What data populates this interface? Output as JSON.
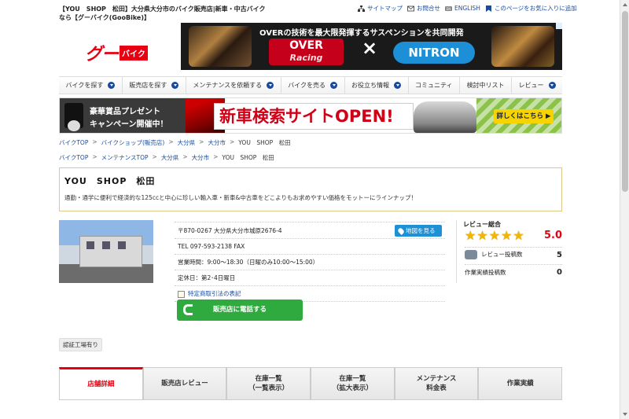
{
  "page": {
    "title": "【YOU　SHOP　松田】大分県大分市のバイク販売店|新車・中古バイクなら【グーバイク(GooBike)】"
  },
  "util_links": [
    {
      "label": "サイトマップ",
      "icon": "sitemap-icon"
    },
    {
      "label": "お問合せ",
      "icon": "mail-icon"
    },
    {
      "label": "ENGLISH",
      "icon": "globe-icon"
    },
    {
      "label": "このページをお気に入りに追加",
      "icon": "bookmark-icon"
    }
  ],
  "logo": {
    "goo": "グー",
    "bike": "バイク"
  },
  "ad_top": {
    "headline": "OVERの技術を最大限発揮するサスペンションを共同開発",
    "brand_left": "OVER",
    "brand_left_sub": "Racing",
    "times": "×",
    "brand_right": "NITRON"
  },
  "gnav": [
    {
      "label": "バイクを探す"
    },
    {
      "label": "販売店を探す"
    },
    {
      "label": "メンテナンスを依頼する"
    },
    {
      "label": "バイクを売る"
    },
    {
      "label": "お役立ち情報"
    },
    {
      "label": "コミュニティ"
    },
    {
      "label": "検討中リスト"
    },
    {
      "label": "レビュー"
    }
  ],
  "ad_mid": {
    "line1": "豪華賞品プレゼント",
    "line2": "キャンペーン開催中！",
    "big": "新車検索サイトOPEN!",
    "detail": "詳しくはこちら ▶"
  },
  "breadcrumb1": [
    "バイクTOP",
    "バイクショップ(販売店)",
    "大分県",
    "大分市",
    "YOU　SHOP　松田"
  ],
  "breadcrumb2": [
    "バイクTOP",
    "メンテナンスTOP",
    "大分県",
    "大分市",
    "YOU　SHOP　松田"
  ],
  "shop": {
    "name": "YOU　SHOP　松田",
    "description": "通勤・通学に便利で経済的な125ccと中心に珍しい輸入車・新車&中古車をどこよりもお求めやすい価格をモットーにラインナップ！",
    "address": "〒870-0267 大分県大分市城原2676-4",
    "map_button": "地図を見る",
    "tel": "TEL 097-593-2138 FAX",
    "hours": "営業時間：9:00～18:30（日曜のみ10:00～15:00）",
    "holiday": "定休日：第2･4日曜日",
    "tokutei": "特定商取引法の表記",
    "call_button": "販売店に電話する",
    "tag": "認証工場有り"
  },
  "review": {
    "label": "レビュー総合",
    "score": "5.0",
    "rating": 5,
    "max_rating": 5,
    "posts_label": "レビュー投稿数",
    "posts": "5",
    "works_label": "作業実績投稿数",
    "works": "0",
    "star_color": "#f2b600"
  },
  "tabs": [
    {
      "label": "店舗詳細",
      "active": true
    },
    {
      "label": "販売店レビュー",
      "active": false
    },
    {
      "label": "在庫一覧\n（一覧表示）",
      "active": false
    },
    {
      "label": "在庫一覧\n（拡大表示）",
      "active": false
    },
    {
      "label": "メンテナンス\n料金表",
      "active": false
    },
    {
      "label": "作業実績",
      "active": false
    }
  ],
  "colors": {
    "brand_red": "#e60012",
    "link_blue": "#1a4b9b",
    "call_green": "#2eaa3e",
    "map_blue": "#1e90d6"
  }
}
